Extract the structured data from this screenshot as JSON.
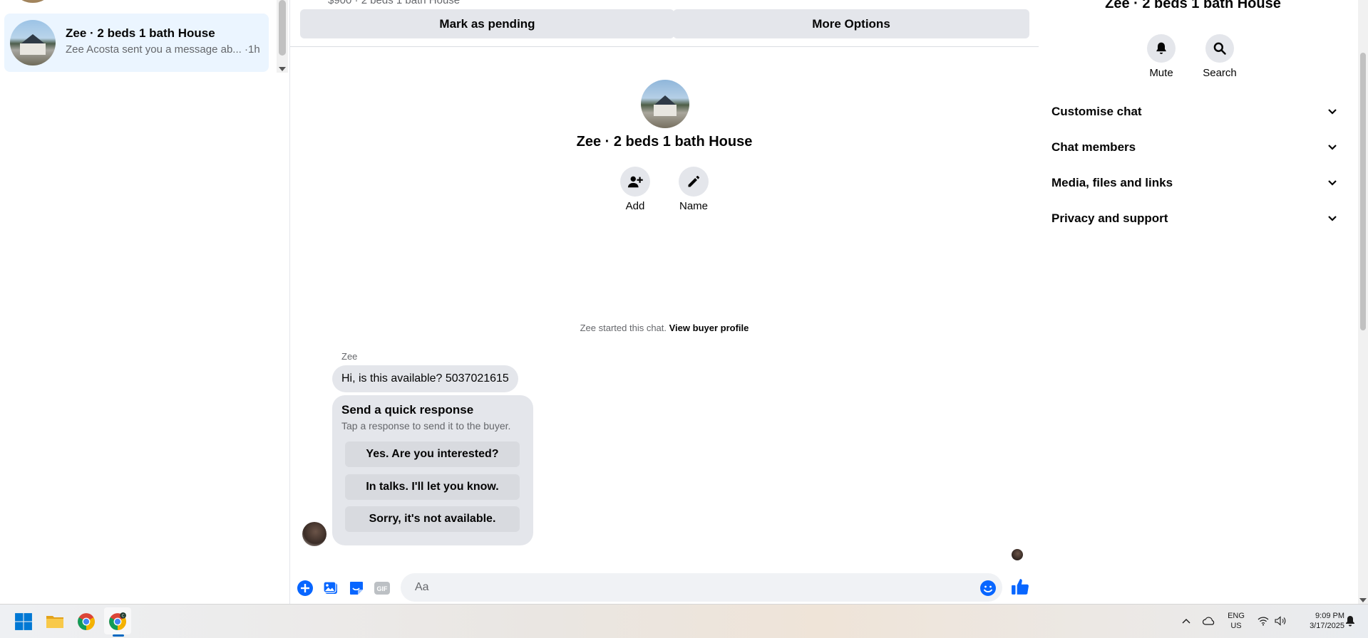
{
  "sidebar": {
    "conversation": {
      "title": "Zee · 2 beds 1 bath House",
      "preview": "Zee Acosta sent you a message ab...",
      "time": " ·1h"
    }
  },
  "chat": {
    "listing_strip": "$900 · 2 beds 1 bath House",
    "mark_pending_label": "Mark as pending",
    "more_options_label": "More Options",
    "profile_name": "Zee · 2 beds 1 bath House",
    "add_label": "Add",
    "name_label": "Name",
    "started_text": "Zee started this chat. ",
    "view_profile_label": "View buyer profile",
    "sender_name": "Zee",
    "message_text": "Hi, is this available? 5037021615",
    "quick_response": {
      "title": "Send a quick response",
      "subtitle": "Tap a response to send it to the buyer.",
      "options": [
        "Yes. Are you interested?",
        "In talks. I'll let you know.",
        "Sorry, it's not available."
      ]
    },
    "composer": {
      "placeholder": "Aa"
    },
    "icons": [
      "plus-icon",
      "photo-icon",
      "sticker-icon",
      "gif-icon",
      "emoji-icon",
      "like-icon"
    ],
    "accent_color": "#0866ff"
  },
  "details": {
    "title": "Zee · 2 beds 1 bath House",
    "mute_label": "Mute",
    "search_label": "Search",
    "sections": [
      "Customise chat",
      "Chat members",
      "Media, files and links",
      "Privacy and support"
    ]
  },
  "taskbar": {
    "lang_line1": "ENG",
    "lang_line2": "US",
    "time": "9:09 PM",
    "date": "3/17/2025"
  }
}
